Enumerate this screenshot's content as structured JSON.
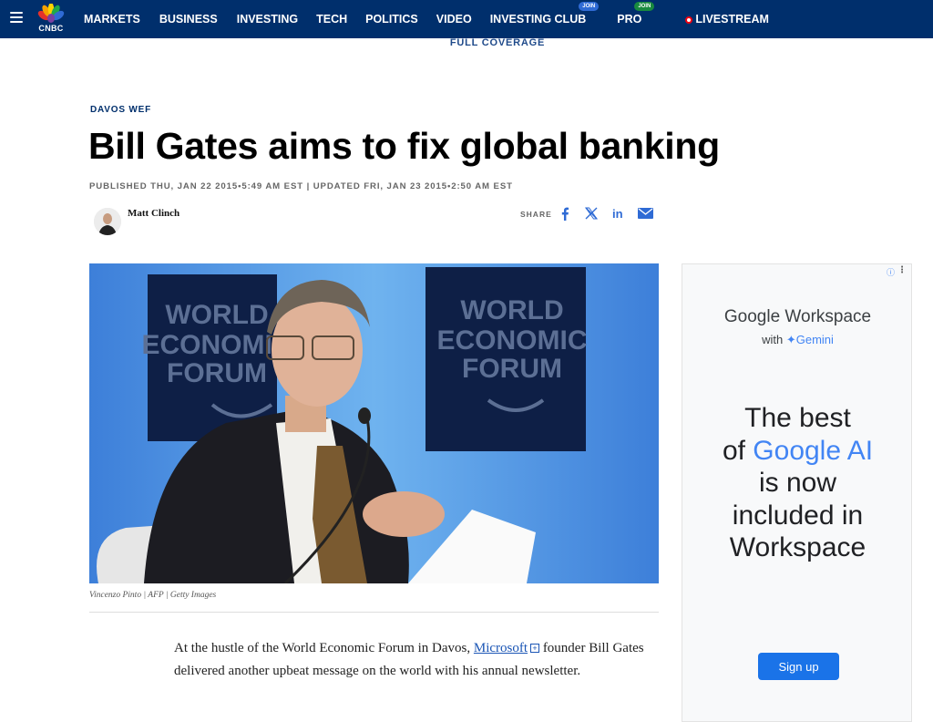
{
  "nav": {
    "items": [
      {
        "label": "MARKETS"
      },
      {
        "label": "BUSINESS"
      },
      {
        "label": "INVESTING"
      },
      {
        "label": "TECH"
      },
      {
        "label": "POLITICS"
      },
      {
        "label": "VIDEO"
      },
      {
        "label": "INVESTING CLUB",
        "badge": "JOIN"
      },
      {
        "label": "PRO",
        "badge": "JOIN"
      },
      {
        "label": "LIVESTREAM"
      }
    ],
    "logo_text": "CNBC"
  },
  "full_coverage": "FULL COVERAGE",
  "article": {
    "kicker": "DAVOS WEF",
    "headline": "Bill Gates aims to fix global banking",
    "dateline": "PUBLISHED THU, JAN 22 2015•5:49 AM EST | UPDATED FRI, JAN 23 2015•2:50 AM EST",
    "author": "Matt Clinch",
    "share_label": "SHARE",
    "image_banner_left": [
      "WORLD",
      "ECONOMIC",
      "FORUM"
    ],
    "image_banner_right": [
      "WORLD",
      "ECONOMIC",
      "FORUM"
    ],
    "caption": "Vincenzo Pinto | AFP | Getty Images",
    "body": {
      "before": "At the hustle of the World Economic Forum in Davos, ",
      "link": "Microsoft",
      "after": " founder Bill Gates delivered another upbeat message on the world with his annual newsletter."
    }
  },
  "ad": {
    "brand": "Google Workspace",
    "with": "with",
    "gemini": "Gemini",
    "headline_1": "The best",
    "headline_2a": "of ",
    "headline_2b": "Google AI",
    "headline_3": "is now",
    "headline_4": "included in",
    "headline_5": "Workspace",
    "cta": "Sign up"
  }
}
